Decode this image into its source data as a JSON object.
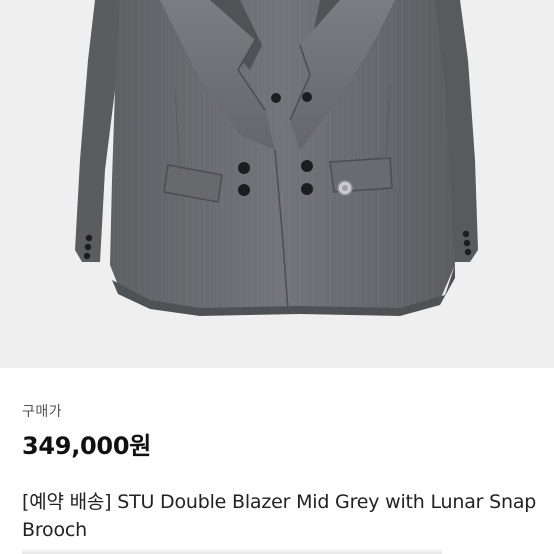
{
  "product": {
    "price_label": "구매가",
    "price": "349,000원",
    "title": "[예약 배송] STU Double Blazer Mid Grey with Lunar Snap Brooch"
  },
  "colors": {
    "image_background": "#efefef",
    "blazer_grey": "#6a6d70",
    "text_primary": "#111111",
    "text_secondary": "#555555"
  }
}
